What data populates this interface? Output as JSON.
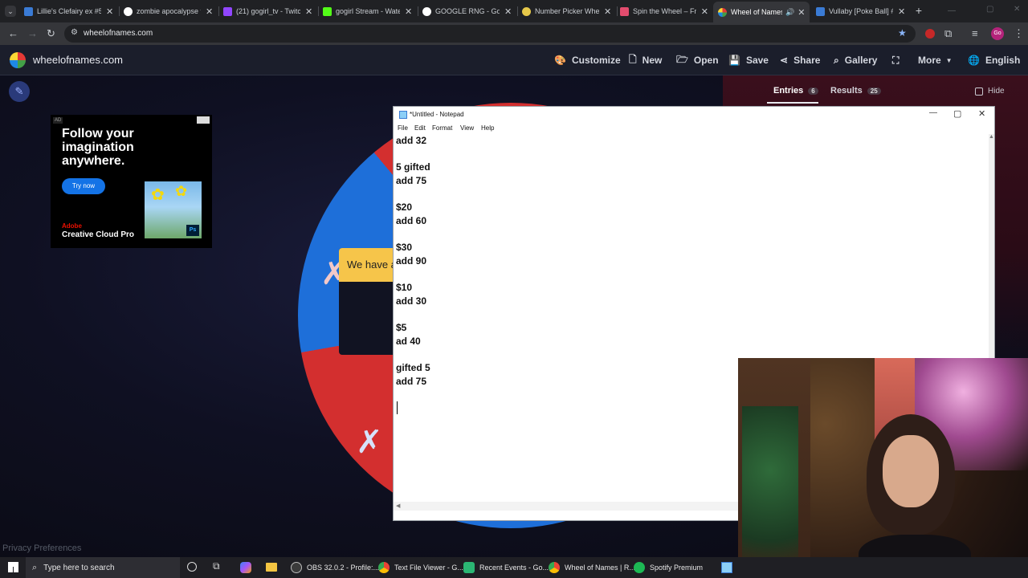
{
  "browser": {
    "tabs": [
      {
        "title": "Lillie's Clefairy ex #5€",
        "icon_color": "#3a7bd5",
        "active": false
      },
      {
        "title": "zombie apocalypse fi",
        "icon_color": "#ffffff",
        "active": false
      },
      {
        "title": "(21) gogirl_tv - Twitch",
        "icon_color": "#9146ff",
        "active": false
      },
      {
        "title": "gogirl Stream - Wate",
        "icon_color": "#53fc18",
        "active": false
      },
      {
        "title": "GOOGLE RNG - Goog",
        "icon_color": "#ffffff",
        "active": false
      },
      {
        "title": "Number Picker Whee",
        "icon_color": "#e6c84a",
        "active": false
      },
      {
        "title": "Spin the Wheel – Fre",
        "icon_color": "#e34c6e",
        "active": false
      },
      {
        "title": "Wheel of Names",
        "icon_color": "#4285f4",
        "active": true
      },
      {
        "title": "Vullaby [Poke Ball] #",
        "icon_color": "#3a7bd5",
        "active": false
      }
    ],
    "url": "wheelofnames.com",
    "profile_initials": "Go"
  },
  "site": {
    "logo_text": "wheelofnames.com",
    "menu": {
      "customize": "Customize",
      "new": "New",
      "open": "Open",
      "save": "Save",
      "share": "Share",
      "gallery": "Gallery",
      "more": "More",
      "language": "English"
    },
    "entries_label": "Entries",
    "entries_count": "6",
    "results_label": "Results",
    "results_count": "25",
    "hide_label": "Hide",
    "banner_text": "We have a",
    "privacy": "Privacy Preferences"
  },
  "ad": {
    "badge": "AD",
    "headline_1": "Follow your",
    "headline_2": "imagination",
    "headline_3": "anywhere.",
    "cta": "Try now",
    "brand_1": "Adobe",
    "brand_2": "Creative Cloud Pro",
    "ps_badge": "Ps"
  },
  "notepad": {
    "title": "*Untitled - Notepad",
    "menu": [
      "File",
      "Edit",
      "Format",
      "View",
      "Help"
    ],
    "lines": [
      "add 32",
      "",
      "5 gifted",
      "add 75",
      "",
      "$20",
      "add 60",
      "",
      "$30",
      "add 90",
      "",
      "$10",
      "add 30",
      "",
      "$5",
      "ad 40",
      "",
      "gifted 5",
      "add 75"
    ]
  },
  "taskbar": {
    "search_placeholder": "Type here to search",
    "apps": [
      {
        "label": "OBS 32.0.2 - Profile:...",
        "color": "#3a3a3a"
      },
      {
        "label": "Text File Viewer - G...",
        "color": "#4285f4"
      },
      {
        "label": "Recent Events - Go...",
        "color": "#2bb673"
      },
      {
        "label": "Wheel of Names | R...",
        "color": "#4285f4"
      },
      {
        "label": "Spotify Premium",
        "color": "#1db954"
      }
    ]
  }
}
